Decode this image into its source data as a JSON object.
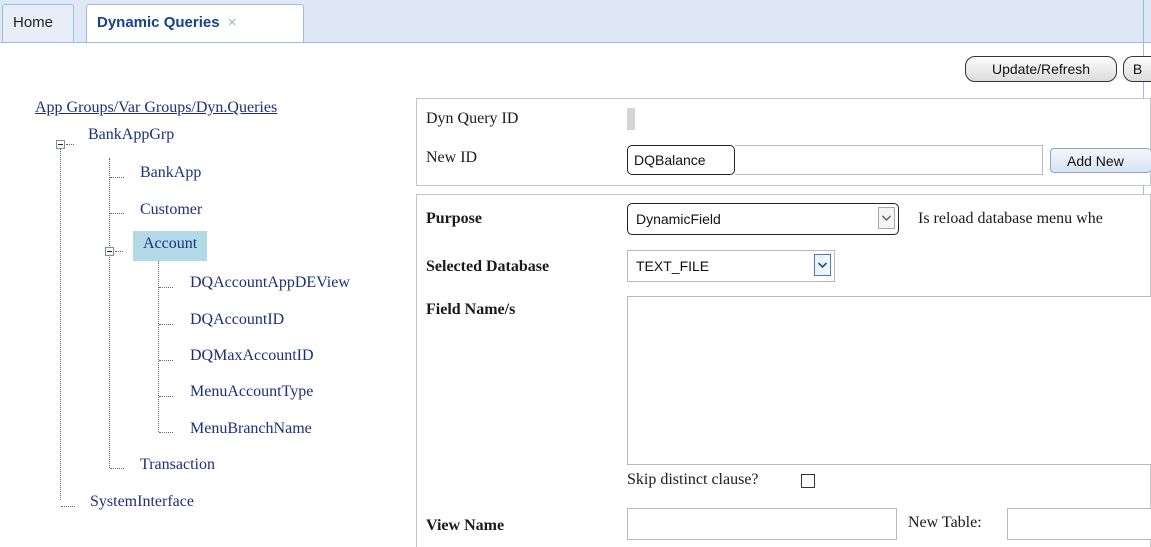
{
  "tabs": {
    "home": "Home",
    "active": "Dynamic Queries",
    "close_glyph": "×"
  },
  "toolbar": {
    "update_refresh": "Update/Refresh",
    "partial_button": "B"
  },
  "tree": {
    "root_link": "App Groups/Var Groups/Dyn.Queries",
    "bank_app_grp": "BankAppGrp",
    "bank_app": "BankApp",
    "customer": "Customer",
    "account": "Account",
    "dq_account_app_de_view": "DQAccountAppDEView",
    "dq_account_id": "DQAccountID",
    "dq_max_account_id": "DQMaxAccountID",
    "menu_account_type": "MenuAccountType",
    "menu_branch_name": "MenuBranchName",
    "transaction": "Transaction",
    "system_interface": "SystemInterface"
  },
  "form": {
    "dyn_query_id_label": "Dyn Query ID",
    "new_id_label": "New ID",
    "new_id_value": "DQBalance",
    "add_new_button": "Add New",
    "purpose_label": "Purpose",
    "purpose_value": "DynamicField",
    "reload_text": "Is reload database menu whe",
    "selected_database_label": "Selected Database",
    "selected_database_value": "TEXT_FILE",
    "field_names_label": "Field Name/s",
    "skip_distinct_label": "Skip distinct clause?",
    "view_name_label": "View Name",
    "new_table_label": "New Table:"
  },
  "icons": {
    "collapse": "minus-square-icon",
    "dropdown": "chevron-down-icon"
  }
}
